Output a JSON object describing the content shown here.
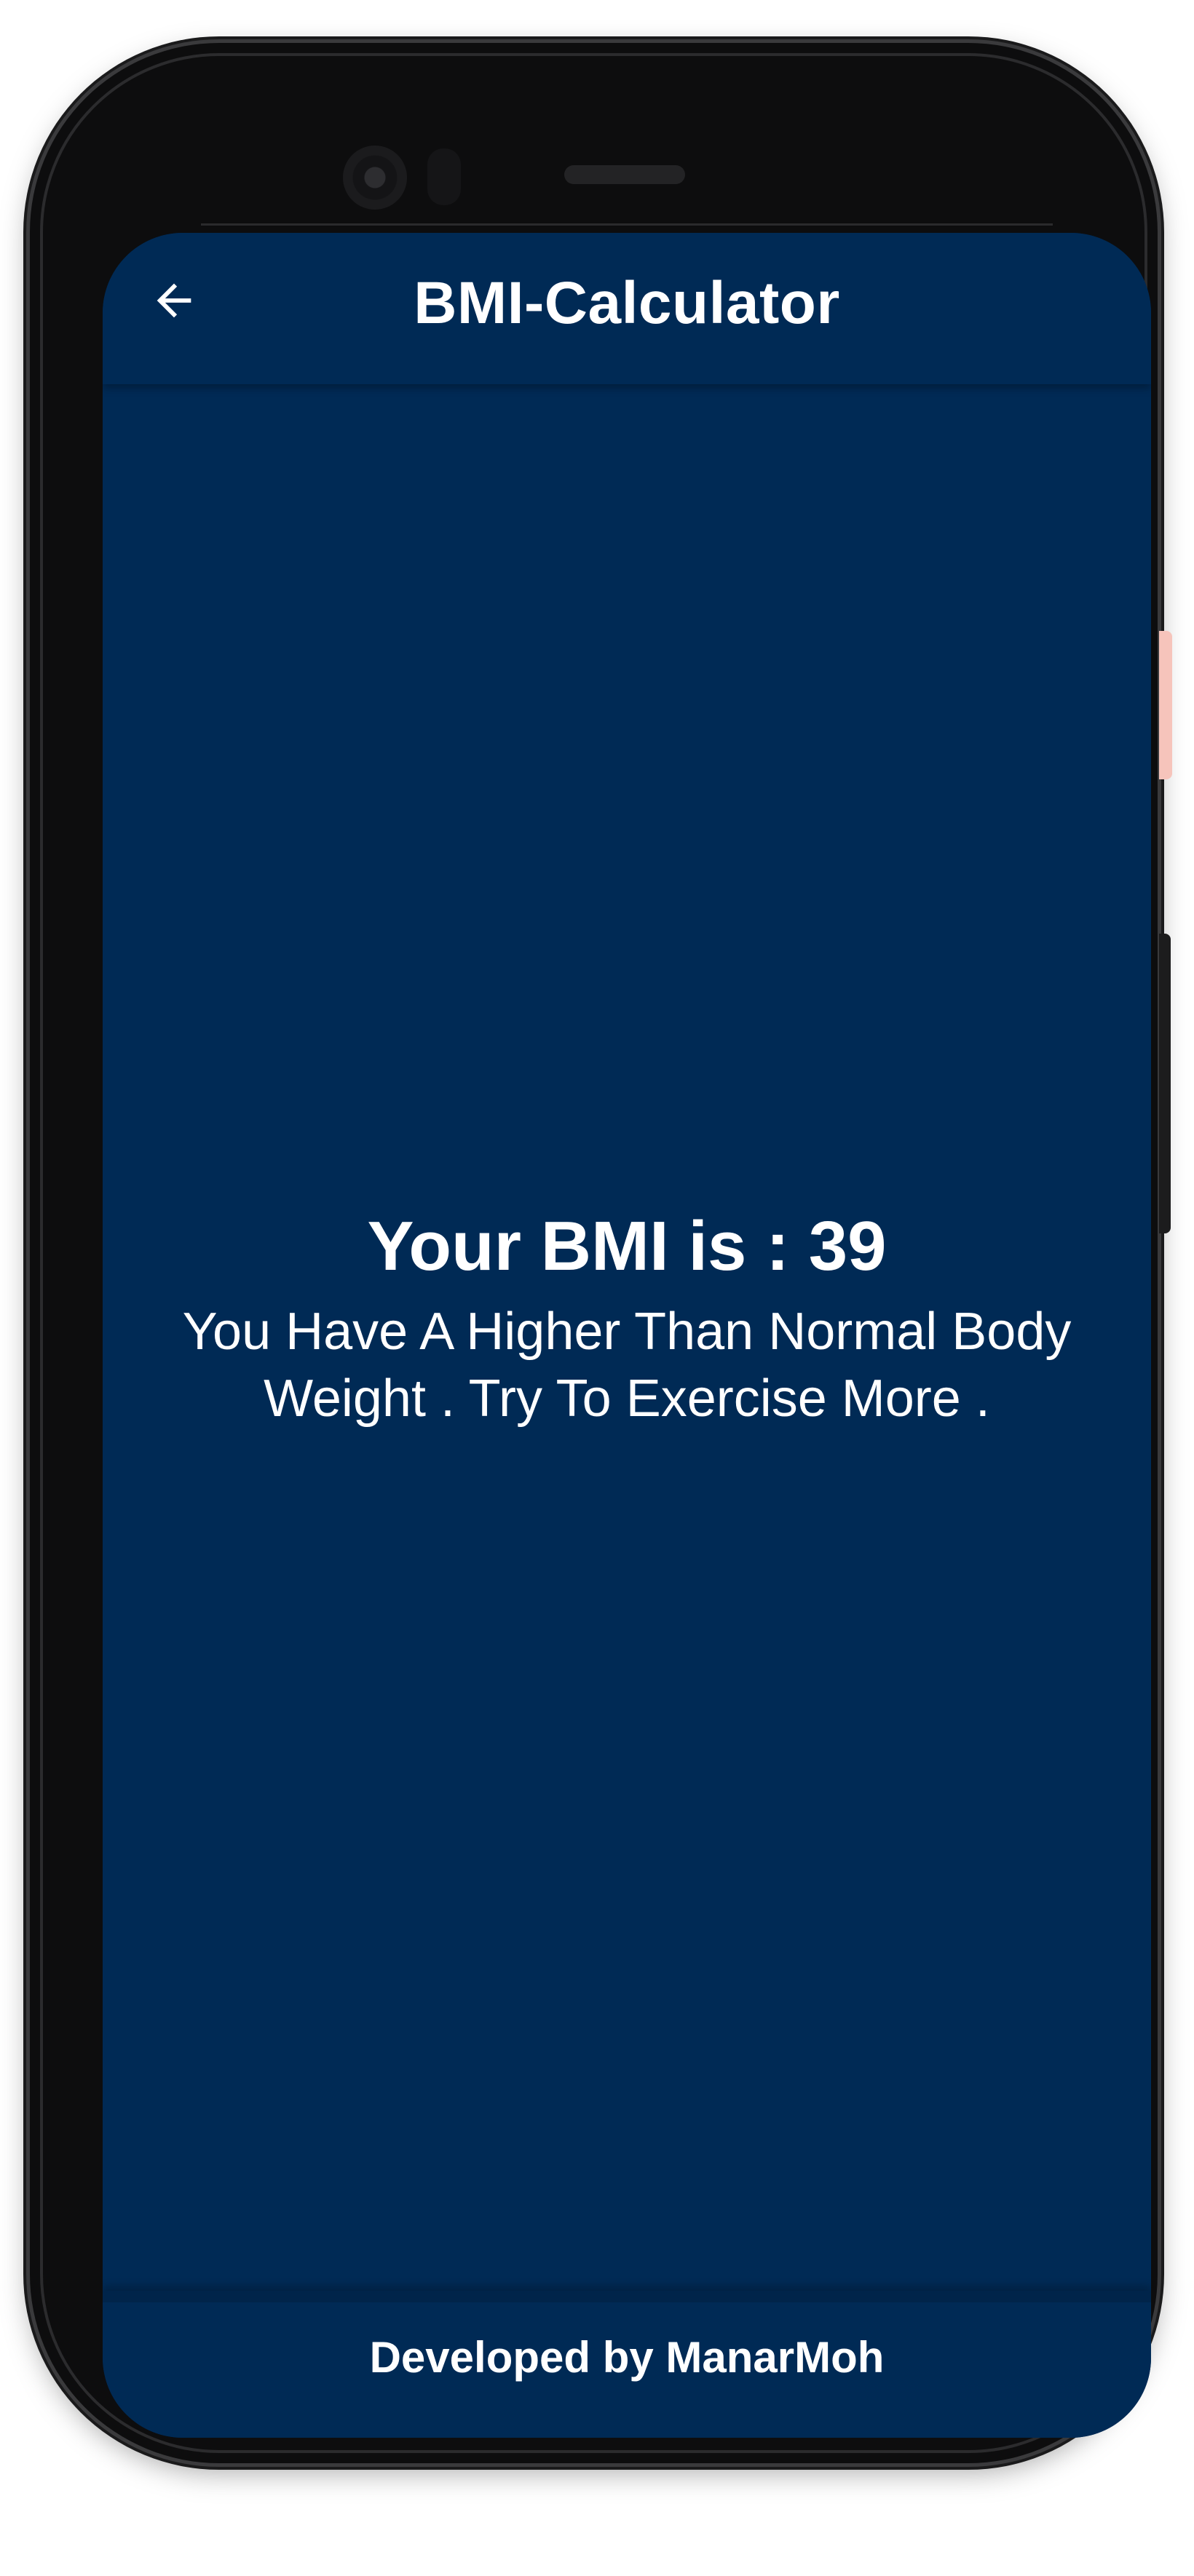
{
  "appbar": {
    "title": "BMI-Calculator",
    "back_icon": "arrow-back-icon"
  },
  "result": {
    "bmi_text": "Your BMI is : 39",
    "message": "You Have A Higher Than Normal Body Weight . Try To Exercise More ."
  },
  "footer": {
    "credit": "Developed by ManarMoh"
  },
  "colors": {
    "background": "#002a55",
    "text": "#ffffff",
    "device_frame": "#0d0d0e"
  }
}
